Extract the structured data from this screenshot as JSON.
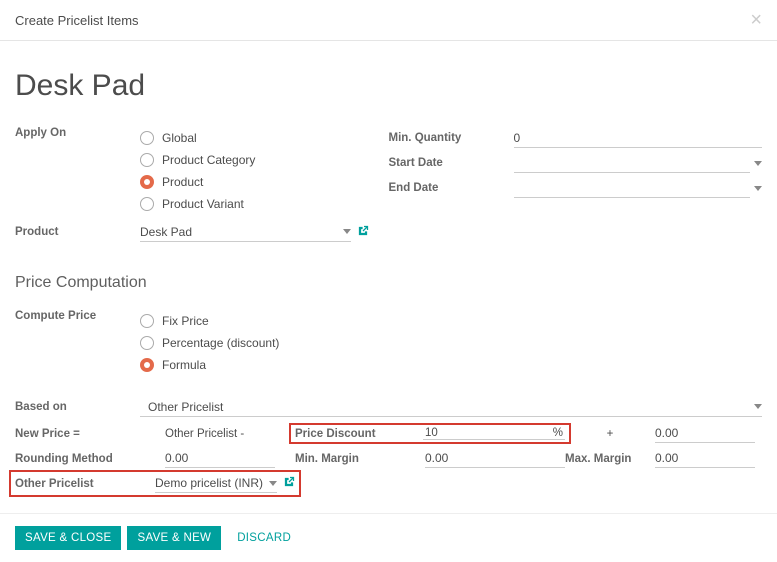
{
  "modal": {
    "title": "Create Pricelist Items"
  },
  "page_title": "Desk Pad",
  "apply_on": {
    "label": "Apply On",
    "options": {
      "global": "Global",
      "category": "Product Category",
      "product": "Product",
      "variant": "Product Variant"
    },
    "selected": "product"
  },
  "product": {
    "label": "Product",
    "value": "Desk Pad"
  },
  "min_quantity": {
    "label": "Min. Quantity",
    "value": "0"
  },
  "start_date": {
    "label": "Start Date",
    "value": ""
  },
  "end_date": {
    "label": "End Date",
    "value": ""
  },
  "section_price_computation": "Price Computation",
  "compute_price": {
    "label": "Compute Price",
    "options": {
      "fix": "Fix Price",
      "percentage": "Percentage (discount)",
      "formula": "Formula"
    },
    "selected": "formula"
  },
  "based_on": {
    "label": "Based on",
    "value": "Other Pricelist"
  },
  "new_price": {
    "label": "New Price =",
    "value": "Other Pricelist -"
  },
  "price_discount": {
    "label": "Price Discount",
    "value": "10",
    "unit": "%"
  },
  "plus_sign": "+",
  "surcharge": {
    "value": "0.00"
  },
  "rounding": {
    "label": "Rounding Method",
    "value": "0.00"
  },
  "min_margin": {
    "label": "Min. Margin",
    "value": "0.00"
  },
  "max_margin": {
    "label": "Max. Margin",
    "value": "0.00"
  },
  "other_pricelist": {
    "label": "Other Pricelist",
    "value": "Demo pricelist (INR)"
  },
  "buttons": {
    "save_close": "SAVE & CLOSE",
    "save_new": "SAVE & NEW",
    "discard": "DISCARD"
  }
}
